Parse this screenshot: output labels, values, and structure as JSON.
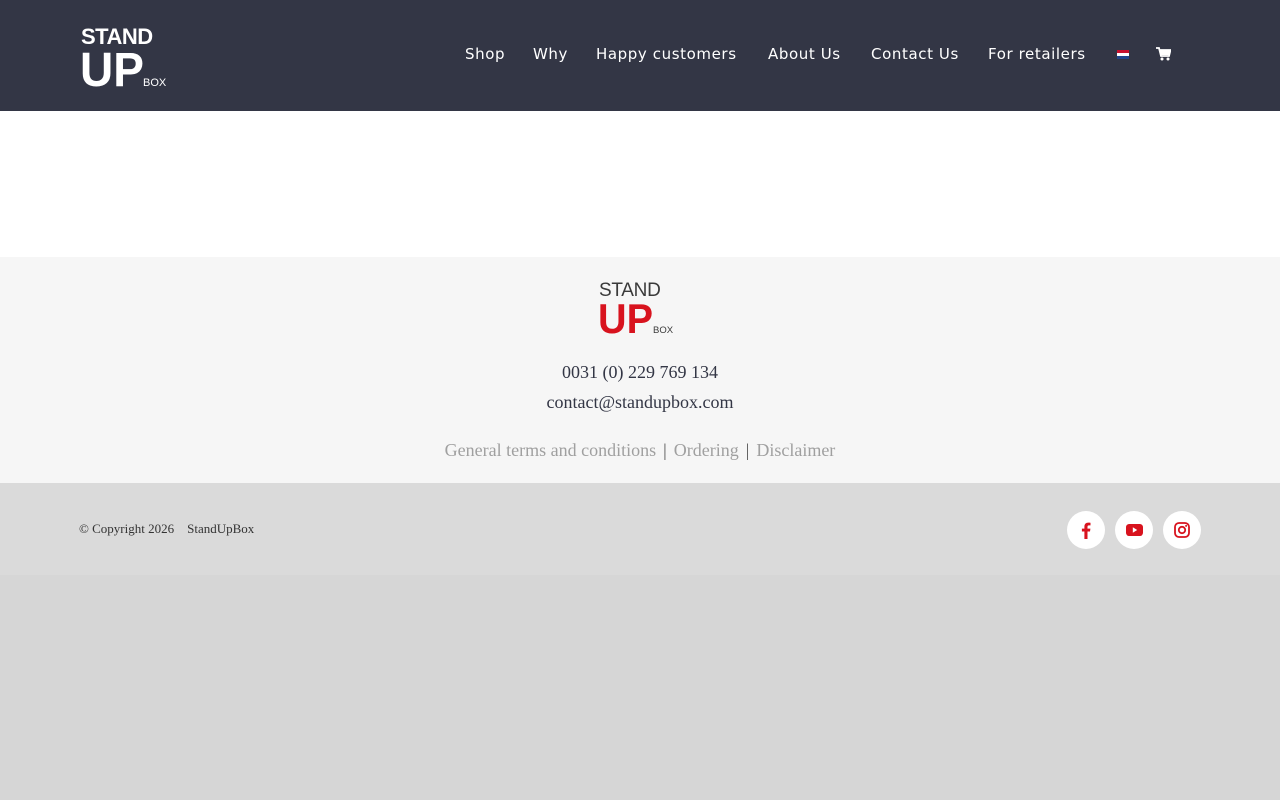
{
  "header": {
    "logo": {
      "line1": "STAND",
      "line2": "UP",
      "line3": "BOX"
    },
    "nav": [
      {
        "label": "Shop"
      },
      {
        "label": "Why"
      },
      {
        "label": "Happy customers"
      },
      {
        "label": "About Us"
      },
      {
        "label": "Contact Us"
      },
      {
        "label": "For retailers"
      }
    ],
    "icons": {
      "language": "dutch-flag-icon",
      "cart": "shopping-cart-icon"
    },
    "background": "#333645"
  },
  "footer": {
    "logo": {
      "line1": "STAND",
      "line2": "UP",
      "line3": "BOX"
    },
    "phone": "0031 (0) 229 769 134",
    "email": "contact@standupbox.com",
    "links": [
      {
        "label": "General terms and conditions"
      },
      {
        "label": "Ordering"
      },
      {
        "label": "Disclaimer"
      }
    ],
    "link_separator": "|",
    "brand_red": "#d8131e"
  },
  "copyright": {
    "text": "© Copyright 2026",
    "brand": "StandUpBox",
    "social": [
      {
        "icon": "facebook-icon"
      },
      {
        "icon": "youtube-icon"
      },
      {
        "icon": "instagram-icon"
      }
    ]
  }
}
